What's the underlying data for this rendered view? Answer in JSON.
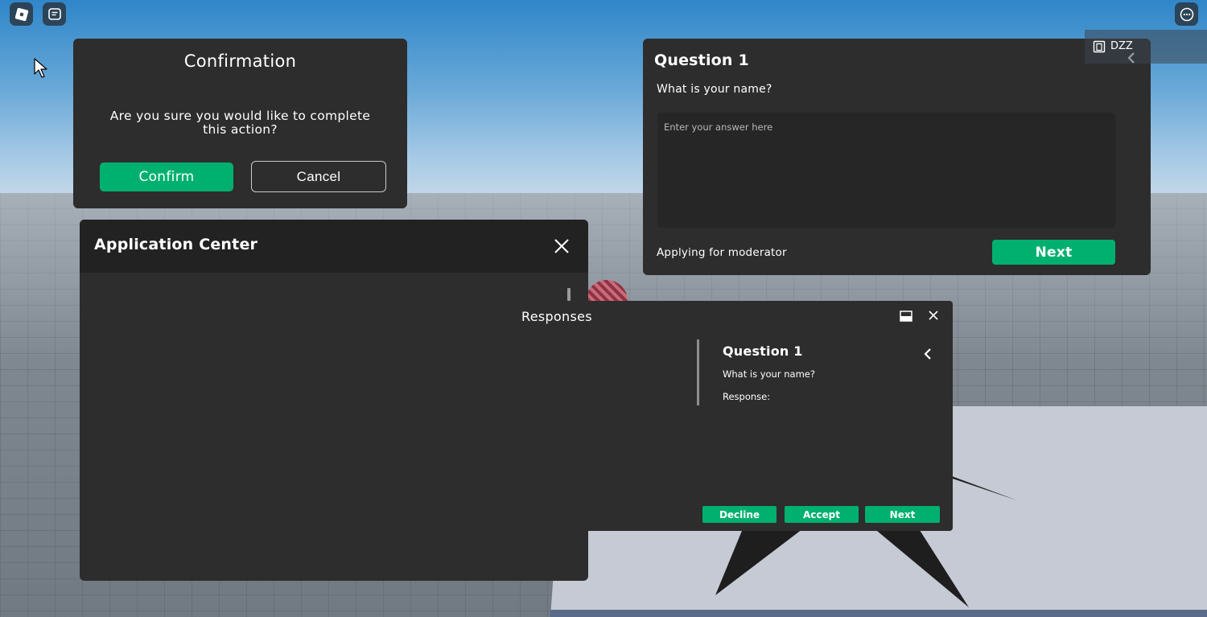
{
  "topbar": {
    "roblox_icon": "roblox-logo-icon",
    "chat_icon": "chat-icon",
    "menu_icon": "more-options-icon"
  },
  "confirmation": {
    "title": "Confirmation",
    "message": "Are you sure you would like to complete this action?",
    "confirm_label": "Confirm",
    "cancel_label": "Cancel"
  },
  "application_center": {
    "title": "Application Center",
    "close_icon": "close-icon"
  },
  "question_panel": {
    "title": "Question 1",
    "prompt": "What is your name?",
    "answer_placeholder": "Enter your answer here",
    "answer_value": "",
    "applying_text": "Applying for moderator",
    "next_label": "Next"
  },
  "player_badge": {
    "name": "DZZ",
    "icon": "player-icon"
  },
  "responses": {
    "title": "Responses",
    "question_title": "Question 1",
    "question_text": "What is your name?",
    "response_label": "Response:",
    "decline_label": "Decline",
    "accept_label": "Accept",
    "next_label": "Next"
  },
  "colors": {
    "panel": "#2d2d2d",
    "panel_header": "#222222",
    "accent_green": "#00b06f"
  }
}
